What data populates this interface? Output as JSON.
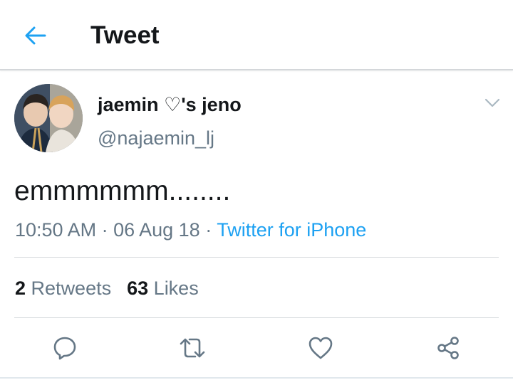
{
  "header": {
    "title": "Tweet",
    "back_icon": "arrow-left-icon",
    "accent_color": "#1da1f2"
  },
  "tweet": {
    "display_name": "jaemin ♡'s jeno",
    "handle": "@najaemin_lj",
    "text": "emmmmmm........",
    "time": "10:50 AM",
    "date": "06 Aug 18",
    "separator": " · ",
    "source": "Twitter for iPhone",
    "retweet_count": "2",
    "retweet_label": "Retweets",
    "like_count": "63",
    "like_label": "Likes"
  },
  "actions": [
    {
      "name": "reply",
      "icon": "reply-icon"
    },
    {
      "name": "retweet",
      "icon": "retweet-icon"
    },
    {
      "name": "like",
      "icon": "heart-icon"
    },
    {
      "name": "share",
      "icon": "share-icon"
    }
  ],
  "colors": {
    "text_primary": "#14171a",
    "text_secondary": "#657786",
    "link": "#1da1f2",
    "icon": "#657786"
  }
}
